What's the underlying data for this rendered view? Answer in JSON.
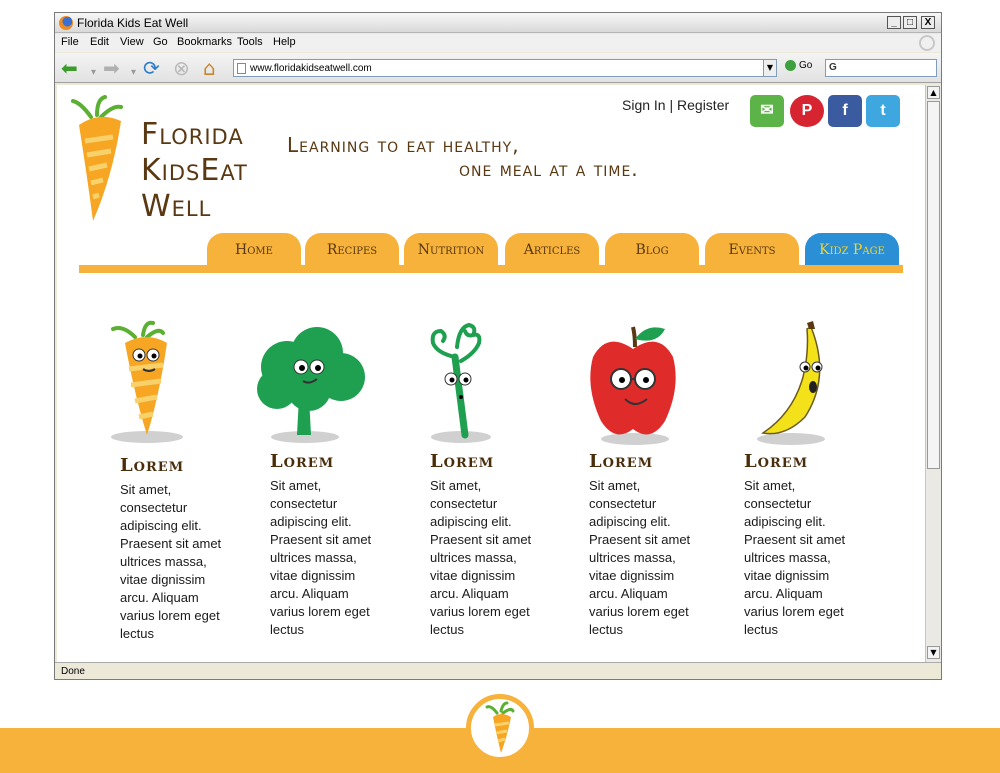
{
  "window": {
    "title": "Florida Kids Eat Well",
    "min_label": "_",
    "max_label": "□",
    "close_label": "X"
  },
  "menubar": [
    "File",
    "Edit",
    "View",
    "Go",
    "Bookmarks",
    "Tools",
    "Help"
  ],
  "navbar": {
    "url": "www.floridakidseatwell.com",
    "go_label": "Go",
    "search_value": "G"
  },
  "status": "Done",
  "page": {
    "logo": {
      "line1": "Florida",
      "line2": "KidsEat",
      "line3": "Well"
    },
    "account": {
      "sign_in": "Sign In",
      "separator": "|",
      "register": "Register"
    },
    "social": [
      {
        "name": "email",
        "label": "✉",
        "color": "#5cb347"
      },
      {
        "name": "pinterest",
        "label": "P",
        "color": "#d62430"
      },
      {
        "name": "facebook",
        "label": "f",
        "color": "#3b5ba0"
      },
      {
        "name": "twitter",
        "label": "t",
        "color": "#3ea7df"
      }
    ],
    "tagline": {
      "line1": "Learning to eat healthy,",
      "line2": "one meal at a time."
    },
    "nav": [
      "Home",
      "Recipes",
      "Nutrition",
      "Articles",
      "Blog",
      "Events",
      "Kidz Page"
    ],
    "cards": [
      {
        "character": "carrot",
        "title": "Lorem",
        "text": "Sit amet, consectetur adipiscing elit. Praesent sit amet ultrices massa, vitae dignissim arcu. Aliquam varius lorem eget lectus"
      },
      {
        "character": "broccoli",
        "title": "Lorem",
        "text": "Sit amet, consectetur adipiscing elit. Praesent sit amet ultrices massa, vitae dignissim arcu. Aliquam varius lorem eget lectus"
      },
      {
        "character": "asparagus",
        "title": "Lorem",
        "text": "Sit amet, consectetur adipiscing elit. Praesent sit amet ultrices massa, vitae dignissim arcu. Aliquam varius lorem eget lectus"
      },
      {
        "character": "apple",
        "title": "Lorem",
        "text": "Sit amet, consectetur adipiscing elit. Praesent sit amet ultrices massa, vitae dignissim arcu. Aliquam varius lorem eget lectus"
      },
      {
        "character": "banana",
        "title": "Lorem",
        "text": "Sit amet, consectetur adipiscing elit. Praesent sit amet ultrices massa, vitae dignissim arcu. Aliquam varius lorem eget lectus"
      }
    ]
  },
  "colors": {
    "brand_orange": "#f6b23a",
    "brand_brown": "#5a3812",
    "active_tab": "#2a8fd4",
    "active_tab_text": "#f6d22e"
  }
}
